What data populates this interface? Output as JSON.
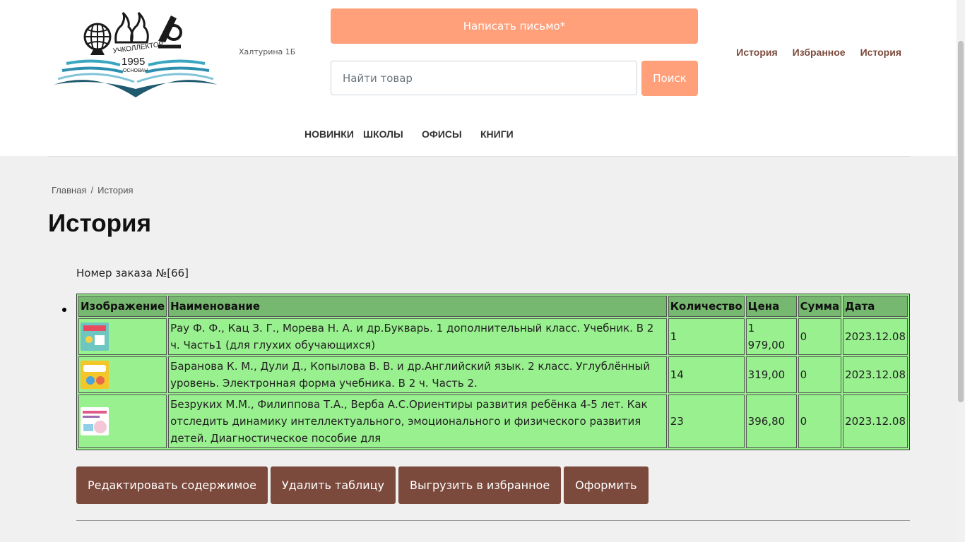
{
  "header": {
    "logo": {
      "text_top": "УЧКОЛЛЕКТОР",
      "year": "1995",
      "text_bottom": "ОСНОВАН"
    },
    "address": "Халтурина 1Б",
    "write_button": "Написать письмо*",
    "search": {
      "placeholder": "Найти товар",
      "button": "Поиск"
    },
    "top_links": [
      "История",
      "Избранное",
      "История"
    ]
  },
  "nav": [
    "НОВИНКИ",
    "ШКОЛЫ",
    "ОФИСЫ",
    "КНИГИ"
  ],
  "breadcrumb": {
    "home": "Главная",
    "separator": "/",
    "current": "История"
  },
  "page_title": "История",
  "order": {
    "number_label": "Номер заказа №[66]",
    "columns": [
      "Изображение",
      "Наименование",
      "Количество",
      "Цена",
      "Сумма",
      "Дата"
    ],
    "rows": [
      {
        "name": "Рау Ф. Ф., Кац З. Г., Морева Н. А. и др.Букварь. 1 дополнительный класс. Учебник. В 2 ч. Часть1 (для глухих обучающихся)",
        "qty": "1",
        "price": "1 979,00",
        "sum": "0",
        "date": "2023.12.08",
        "cover": "#6ec6c0"
      },
      {
        "name": "Баранова К. М., Дули Д., Копылова В. В. и др.Английский язык. 2 класс. Углублённый уровень. Электронная форма учебника. В 2 ч. Часть 2.",
        "qty": "14",
        "price": "319,00",
        "sum": "0",
        "date": "2023.12.08",
        "cover": "#f3c62a"
      },
      {
        "name": "Безруких М.М., Филиппова Т.А., Верба А.С.Ориентиры развития ребёнка 4-5 лет. Как отследить динамику интеллектуального, эмоционального и физического развития детей. Диагностическое пособие для",
        "qty": "23",
        "price": "396,80",
        "sum": "0",
        "date": "2023.12.08",
        "cover": "#f4c7d6"
      }
    ]
  },
  "actions": [
    "Редактировать содержимое",
    "Удалить таблицу",
    "Выгрузить в избранное",
    "Оформить"
  ],
  "colors": {
    "accent": "#ffa07a",
    "brown": "#7b4a3c",
    "table_bg": "#98f08e",
    "table_header": "#76b86f"
  }
}
